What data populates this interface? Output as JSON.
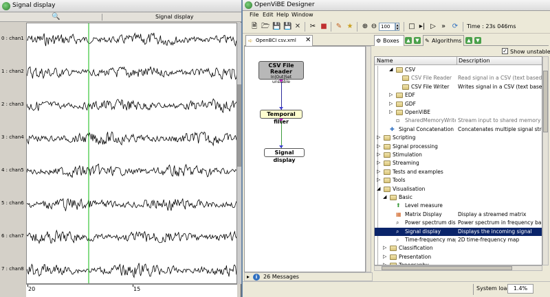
{
  "signal_window": {
    "title": "Signal display",
    "toolbar_title": "Signal display",
    "zoom_icon": "magnifier-icon",
    "channels": [
      "0 : chan1",
      "1 : chan2",
      "2 : chan3",
      "3 : chan4",
      "4 : chan5",
      "5 : chan6",
      "6 : chan7",
      "7 : chan8"
    ],
    "x_ticks": [
      "20",
      "15"
    ],
    "cursor_color": "#35c435",
    "trace_color": "#000000"
  },
  "designer": {
    "title": "OpenViBE Designer",
    "menu": [
      "File",
      "Edit",
      "Help",
      "Window"
    ],
    "zoom_value": "100",
    "time_label": "Time : 23s 046ms",
    "scenario_tab": "OpenBCI csv.xml",
    "boxes": {
      "csv_reader": {
        "name": "CSV File Reader",
        "io": "In|Out|Set",
        "status": "unstable"
      },
      "temporal_filter": {
        "name": "Temporal filter"
      },
      "signal_display": {
        "name": "Signal display"
      }
    },
    "messages": "26 Messages",
    "panel_tabs": {
      "boxes": "Boxes",
      "algorithms": "Algorithms"
    },
    "show_unstable_label": "Show unstable",
    "show_unstable_checked": "✓",
    "tree_columns": {
      "name": "Name",
      "description": "Description"
    },
    "tree_rows": [
      {
        "name": "CSV",
        "desc": "",
        "indent": 2,
        "expander": "◢",
        "icon": "folder",
        "grey": false
      },
      {
        "name": "CSV File Reader",
        "desc": "Read signal in a CSV (text based) file",
        "indent": 3,
        "expander": "",
        "icon": "folder",
        "grey": true
      },
      {
        "name": "CSV File Writer",
        "desc": "Writes signal in a CSV (text based) file",
        "indent": 3,
        "expander": "",
        "icon": "folder",
        "grey": false
      },
      {
        "name": "EDF",
        "desc": "",
        "indent": 2,
        "expander": "▷",
        "icon": "folder",
        "grey": false
      },
      {
        "name": "GDF",
        "desc": "",
        "indent": 2,
        "expander": "▷",
        "icon": "folder",
        "grey": false
      },
      {
        "name": "OpenViBE",
        "desc": "",
        "indent": 2,
        "expander": "▷",
        "icon": "folder",
        "grey": false
      },
      {
        "name": "SharedMemoryWriter",
        "desc": "Stream input to shared memory",
        "indent": 2,
        "expander": "",
        "icon": "doc",
        "grey": true
      },
      {
        "name": "Signal Concatenation",
        "desc": "Concatenates multiple signal streams",
        "indent": 1,
        "expander": "",
        "icon": "plus",
        "grey": false
      },
      {
        "name": "Scripting",
        "desc": "",
        "indent": 0,
        "expander": "▷",
        "icon": "folder",
        "grey": false
      },
      {
        "name": "Signal processing",
        "desc": "",
        "indent": 0,
        "expander": "▷",
        "icon": "folder",
        "grey": false
      },
      {
        "name": "Stimulation",
        "desc": "",
        "indent": 0,
        "expander": "▷",
        "icon": "folder",
        "grey": false
      },
      {
        "name": "Streaming",
        "desc": "",
        "indent": 0,
        "expander": "▷",
        "icon": "folder",
        "grey": false
      },
      {
        "name": "Tests and examples",
        "desc": "",
        "indent": 0,
        "expander": "▷",
        "icon": "folder",
        "grey": false
      },
      {
        "name": "Tools",
        "desc": "",
        "indent": 0,
        "expander": "▷",
        "icon": "folder",
        "grey": false
      },
      {
        "name": "Visualisation",
        "desc": "",
        "indent": 0,
        "expander": "◢",
        "icon": "folder",
        "grey": false
      },
      {
        "name": "Basic",
        "desc": "",
        "indent": 1,
        "expander": "◢",
        "icon": "folder",
        "grey": false
      },
      {
        "name": "Level measure",
        "desc": "",
        "indent": 2,
        "expander": "",
        "icon": "arrow",
        "grey": false
      },
      {
        "name": "Matrix Display",
        "desc": "Display a streamed matrix",
        "indent": 2,
        "expander": "",
        "icon": "matrix",
        "grey": false
      },
      {
        "name": "Power spectrum display",
        "desc": "Power spectrum in frequency bands",
        "indent": 2,
        "expander": "",
        "icon": "magnifier",
        "grey": false
      },
      {
        "name": "Signal display",
        "desc": "Displays the incoming signal",
        "indent": 2,
        "expander": "",
        "icon": "magnifier",
        "grey": false,
        "selected": true
      },
      {
        "name": "Time-frequency map display",
        "desc": "2D time-frequency map",
        "indent": 2,
        "expander": "",
        "icon": "magnifier",
        "grey": false
      },
      {
        "name": "Classification",
        "desc": "",
        "indent": 1,
        "expander": "▷",
        "icon": "folder",
        "grey": false
      },
      {
        "name": "Presentation",
        "desc": "",
        "indent": 1,
        "expander": "▷",
        "icon": "folder",
        "grey": false
      },
      {
        "name": "Topography",
        "desc": "",
        "indent": 1,
        "expander": "▷",
        "icon": "folder",
        "grey": false
      }
    ],
    "system_load_label": "System load :",
    "system_load_value": "1.4%"
  }
}
